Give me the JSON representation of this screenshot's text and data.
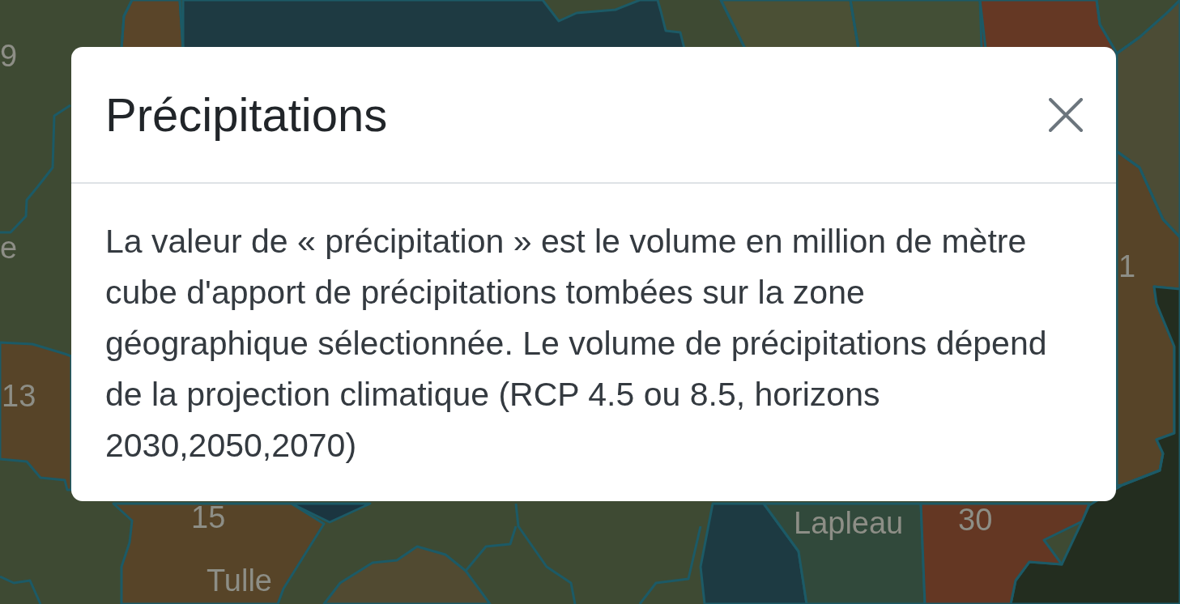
{
  "map": {
    "labels": [
      "9",
      "e",
      "13",
      "15",
      "Tulle",
      "Lapleau",
      "30",
      "1"
    ]
  },
  "dialog": {
    "title": "Précipitations",
    "body": "La valeur de « précipitation » est le volume en million de mètre cube d'apport de précipitations tombées sur la zone géographique sélectionnée. Le volume de précipitations dépend de la projection climatique (RCP 4.5 ou 8.5, horizons 2030,2050,2070)"
  }
}
